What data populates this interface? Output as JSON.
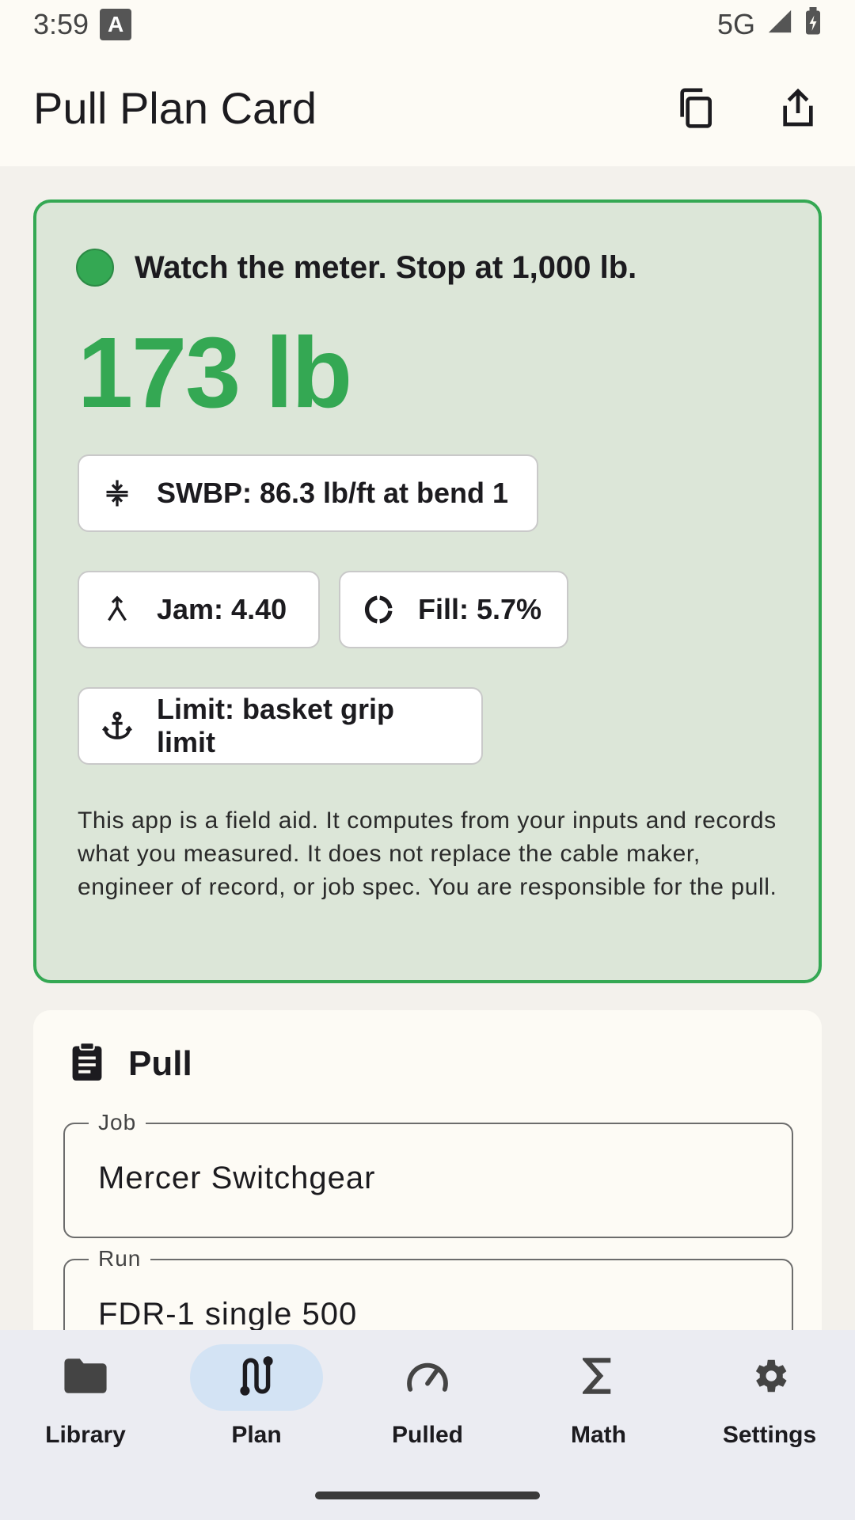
{
  "status_bar": {
    "time": "3:59",
    "badge": "A",
    "network": "5G"
  },
  "app_bar": {
    "title": "Pull Plan Card",
    "copy_icon": "copy-icon",
    "share_icon": "share-icon"
  },
  "status_card": {
    "indicator_color": "#34a853",
    "headline": "Watch the meter. Stop at 1,000 lb.",
    "tension": "173 lb",
    "chips": {
      "swbp": {
        "label": "SWBP: 86.3 lb/ft at bend 1",
        "icon": "compress-icon"
      },
      "jam": {
        "label": "Jam: 4.40",
        "icon": "merge-icon"
      },
      "fill": {
        "label": "Fill: 5.7%",
        "icon": "donut-icon"
      },
      "limit": {
        "label": "Limit: basket grip limit",
        "icon": "anchor-icon"
      }
    },
    "disclaimer": "This app is a field aid. It computes from your inputs and records what you measured. It does not replace the cable maker, engineer of record, or job spec. You are responsible for the pull."
  },
  "pull_section": {
    "title": "Pull",
    "icon": "clipboard-icon",
    "fields": {
      "job": {
        "label": "Job",
        "value": "Mercer Switchgear"
      },
      "run": {
        "label": "Run",
        "value": "FDR-1 single 500"
      }
    }
  },
  "bottom_nav": {
    "active": "Plan",
    "items": [
      {
        "label": "Library",
        "icon": "folder-icon"
      },
      {
        "label": "Plan",
        "icon": "route-icon"
      },
      {
        "label": "Pulled",
        "icon": "speedometer-icon"
      },
      {
        "label": "Math",
        "icon": "sigma-icon"
      },
      {
        "label": "Settings",
        "icon": "gear-icon"
      }
    ]
  },
  "colors": {
    "accent_green": "#34a853",
    "card_green": "#dce6d8",
    "nav_active": "#d3e3f4"
  }
}
